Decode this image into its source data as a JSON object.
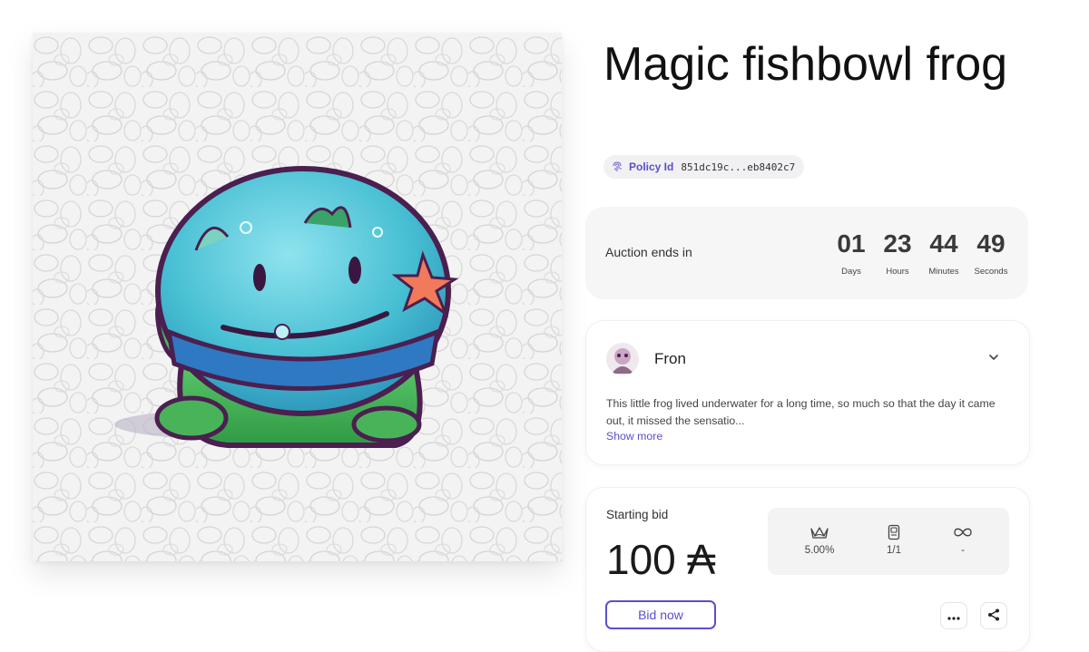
{
  "nft": {
    "title": "Magic fishbowl frog",
    "policy_label": "Policy Id",
    "policy_id": "851dc19c...eb8402c7"
  },
  "auction": {
    "label": "Auction ends in",
    "days": "01",
    "days_label": "Days",
    "hours": "23",
    "hours_label": "Hours",
    "minutes": "44",
    "minutes_label": "Minutes",
    "seconds": "49",
    "seconds_label": "Seconds"
  },
  "creator": {
    "name": "Fron",
    "description": "This little frog lived underwater for a long time, so much so that the day it came out, it missed the sensatio...",
    "show_more": "Show more"
  },
  "bid": {
    "label": "Starting bid",
    "value": "100 ₳",
    "royalty": "5.00%",
    "edition": "1/1",
    "supply": "-",
    "button": "Bid now"
  },
  "icons": {
    "policy": "fingerprint-icon",
    "chevron": "chevron-down-icon",
    "royalty": "crown-icon",
    "edition": "card-icon",
    "supply": "infinity-icon",
    "more": "more-icon",
    "share": "share-icon"
  },
  "colors": {
    "accent": "#5a4fcf",
    "panel": "#f6f6f7"
  }
}
